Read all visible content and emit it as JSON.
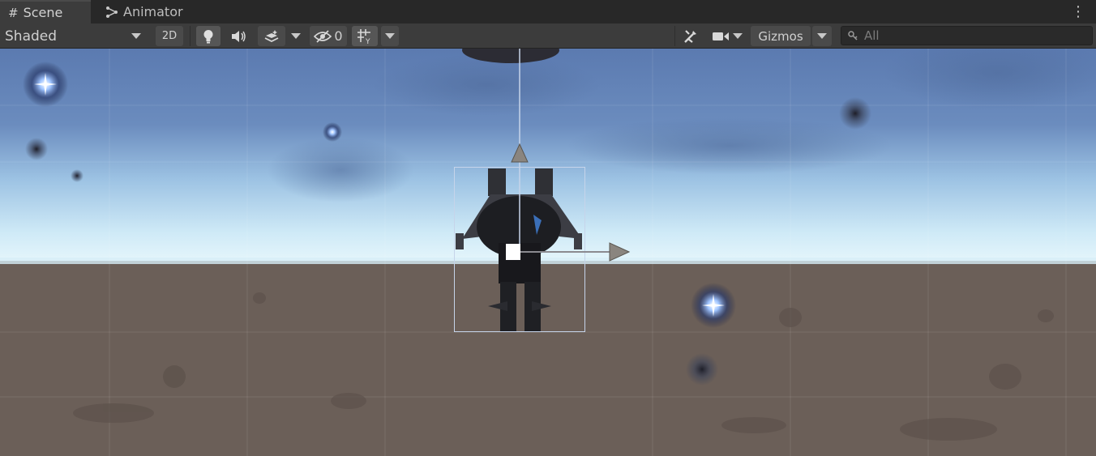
{
  "tabs": [
    {
      "label": "Scene",
      "icon": "hash-grid-icon",
      "active": true
    },
    {
      "label": "Animator",
      "icon": "animator-icon",
      "active": false
    }
  ],
  "toolbar": {
    "draw_mode": "Shaded",
    "mode_2d": "2D",
    "hidden_count": "0",
    "gizmos": "Gizmos"
  },
  "search": {
    "placeholder": "All"
  },
  "colors": {
    "sky_top": "#5a7fb3",
    "horizon": "#dff2fb",
    "ground": "#6b5f58",
    "selection": "#b8c8e0"
  }
}
